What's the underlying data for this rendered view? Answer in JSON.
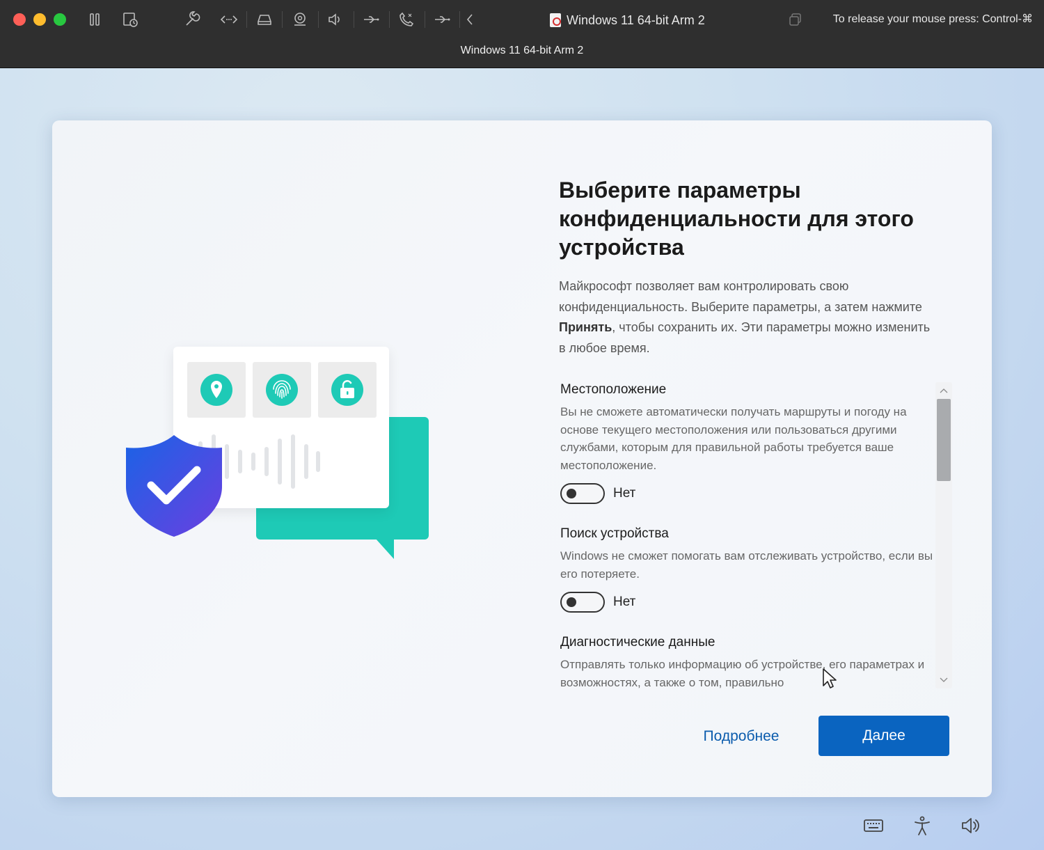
{
  "titlebar": {
    "window_title": "Windows 11 64-bit Arm 2",
    "release_hint": "To release your mouse press: Control-⌘",
    "sub_title": "Windows 11 64-bit Arm 2"
  },
  "oobe": {
    "heading": "Выберите параметры конфиденциальности для этого устройства",
    "intro_before": "Майкрософт позволяет вам контролировать свою конфиденциальность. Выберите параметры, а затем нажмите ",
    "intro_bold": "Принять",
    "intro_after": ", чтобы сохранить их. Эти параметры можно изменить в любое время.",
    "settings": [
      {
        "title": "Местоположение",
        "description": "Вы не сможете автоматически получать маршруты и погоду на основе текущего местоположения или пользоваться другими службами, которым для правильной работы требуется ваше местоположение.",
        "toggle_label": "Нет"
      },
      {
        "title": "Поиск устройства",
        "description": "Windows не сможет помогать вам отслеживать устройство, если вы его потеряете.",
        "toggle_label": "Нет"
      },
      {
        "title": "Диагностические данные",
        "description": "Отправлять только информацию об устройстве, его параметрах и возможностях, а также о том, правильно"
      }
    ],
    "learn_more_label": "Подробнее",
    "next_label": "Далее"
  },
  "colors": {
    "accent": "#0a64c0",
    "link": "#0b5cad",
    "teal": "#1ecab6",
    "shield_blue": "#1f5fe0"
  }
}
